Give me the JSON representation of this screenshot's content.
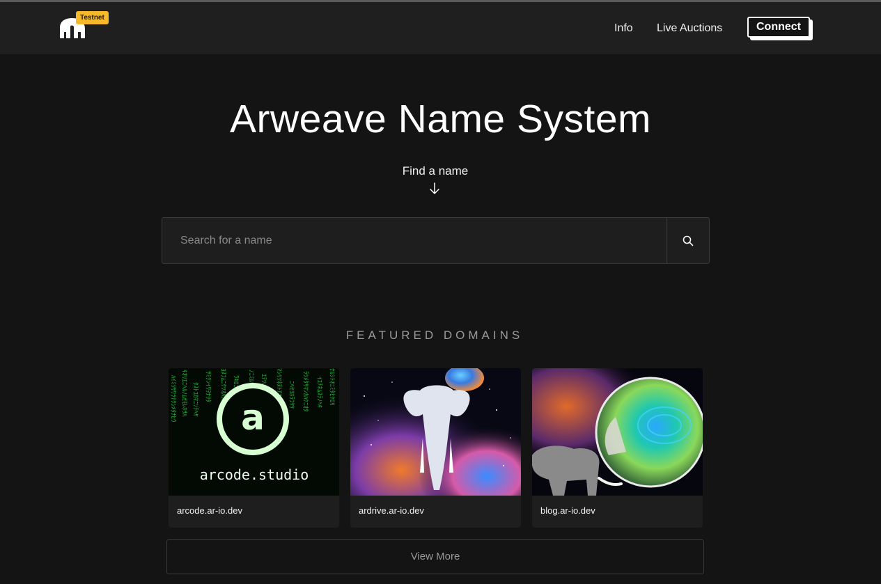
{
  "header": {
    "badge": "Testnet",
    "nav": [
      {
        "label": "Info"
      },
      {
        "label": "Live Auctions"
      }
    ],
    "connect_label": "Connect"
  },
  "hero": {
    "title": "Arweave Name System",
    "find_label": "Find a name"
  },
  "search": {
    "placeholder": "Search for a name"
  },
  "featured": {
    "heading": "FEATURED DOMAINS",
    "domains": [
      {
        "label": "arcode.ar-io.dev",
        "image_text": "arcode.studio",
        "image_letter": "a"
      },
      {
        "label": "ardrive.ar-io.dev"
      },
      {
        "label": "blog.ar-io.dev"
      }
    ],
    "view_more": "View More"
  },
  "colors": {
    "background": "#141414",
    "header": "#1f1f1f",
    "badge": "#f5b92a",
    "matrix_green": "#2bd84a"
  }
}
